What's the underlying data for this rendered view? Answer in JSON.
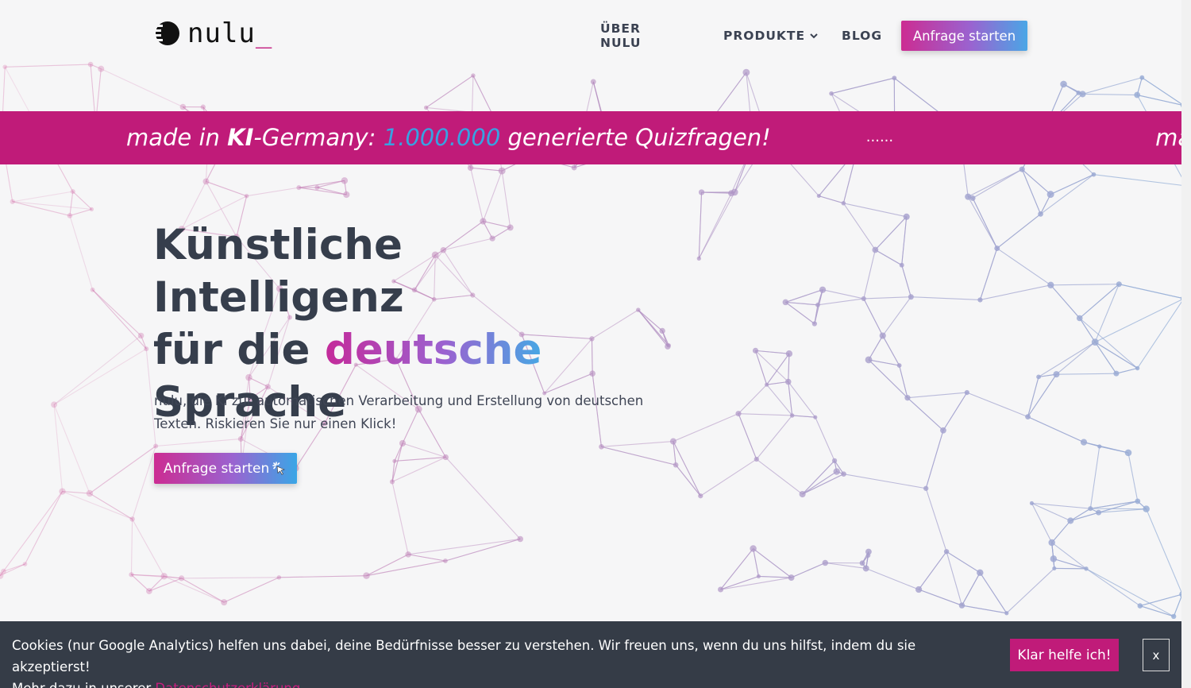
{
  "logo": {
    "text": "nulu",
    "cursor": "_"
  },
  "nav": {
    "items": [
      {
        "label": "ÜBER NULU"
      },
      {
        "label": "PRODUKTE"
      },
      {
        "label": "BLOG"
      }
    ],
    "cta_label": "Anfrage starten"
  },
  "ticker": {
    "prefix": "made in ",
    "ki": "KI",
    "middle": "-Germany: ",
    "number": "1.000.000",
    "suffix": " generierte Quizfragen!",
    "separator": "......",
    "repeat": "made in"
  },
  "hero": {
    "title_line1": "Künstliche Intelligenz",
    "title_line2_prefix": "für die ",
    "title_highlight": "deutsche",
    "title_line3": "Sprache",
    "text": "nulu, die KI zur automatischen Verarbeitung und Erstellung von deutschen Texten. Riskieren Sie nur einen Klick!",
    "cta_label": "Anfrage starten"
  },
  "cookie": {
    "text": "Cookies (nur Google Analytics) helfen uns dabei, deine Bedürfnisse besser zu verstehen. Wir freuen uns, wenn du uns hilfst, indem du sie akzeptierst!",
    "more_prefix": "Mehr dazu in unserer ",
    "link_label": "Datenschutzerklärung",
    "accept_label": "Klar helfe ich!",
    "close_label": "x"
  },
  "colors": {
    "accent": "#c01b79",
    "gradient_start": "#cc2c92",
    "gradient_mid": "#9a63d0",
    "gradient_end": "#47a7e4",
    "cookie_bg": "#353c47"
  }
}
